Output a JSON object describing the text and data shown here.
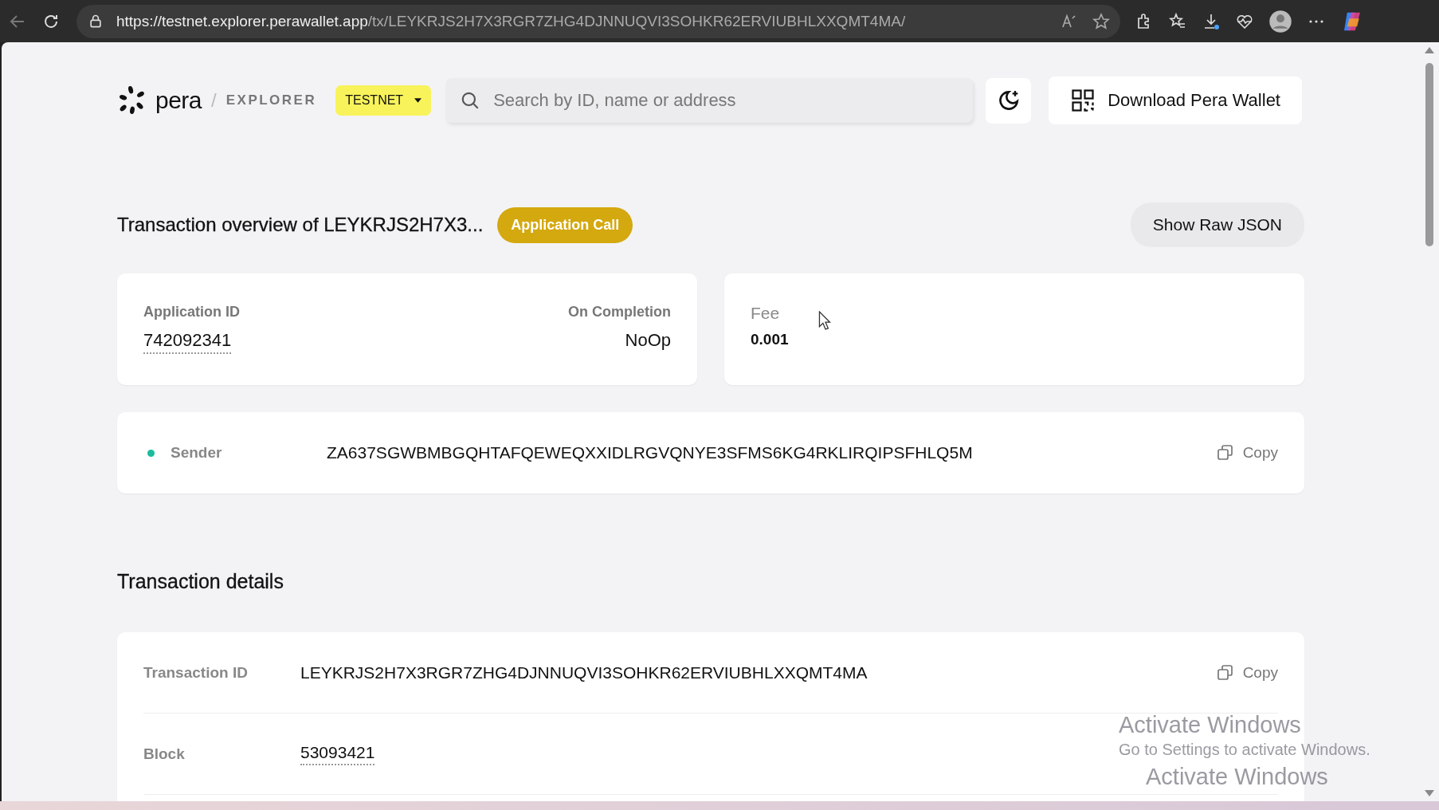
{
  "browser": {
    "url_host": "https://testnet.explorer.perawallet.app",
    "url_path": "/tx/LEYKRJS2H7X3RGR7ZHG4DJNNUQVI3SOHKR62ERVIUBHLXXQMT4MA/"
  },
  "header": {
    "logo_text": "pera",
    "separator": "/",
    "section": "EXPLORER",
    "network": "TESTNET",
    "search": {
      "placeholder": "Search by ID, name or address"
    },
    "download_button": "Download Pera Wallet"
  },
  "overview": {
    "title": "Transaction overview of LEYKRJS2H7X3...",
    "type_badge": "Application Call",
    "raw_button": "Show Raw JSON"
  },
  "summary_cards": [
    {
      "fields": [
        {
          "label": "Application ID",
          "value": "742092341",
          "kind": "link"
        },
        {
          "label": "On Completion",
          "value": "NoOp",
          "kind": "text"
        }
      ]
    },
    {
      "fields": [
        {
          "label": "Fee",
          "value": "0.001",
          "kind": "amount"
        }
      ]
    }
  ],
  "sender": {
    "label": "Sender",
    "color": "#1abc9c",
    "address": "ZA637SGWBMBGQHTAFQEWEQXXIDLRGVQNYE3SFMS6KG4RKLIRQIPSFHLQ5M",
    "copy": "Copy"
  },
  "details": {
    "title": "Transaction details",
    "rows": [
      {
        "label": "Transaction ID",
        "value": "LEYKRJS2H7X3RGR7ZHG4DJNNUQVI3SOHKR62ERVIUBHLXXQMT4MA",
        "kind": "text",
        "copy": "Copy"
      },
      {
        "label": "Block",
        "value": "53093421",
        "kind": "link"
      }
    ]
  },
  "os_notice": [
    {
      "title": "Activate Windows",
      "text": "Go to Settings to activate Windows."
    },
    {
      "title": "Activate Windows"
    }
  ]
}
